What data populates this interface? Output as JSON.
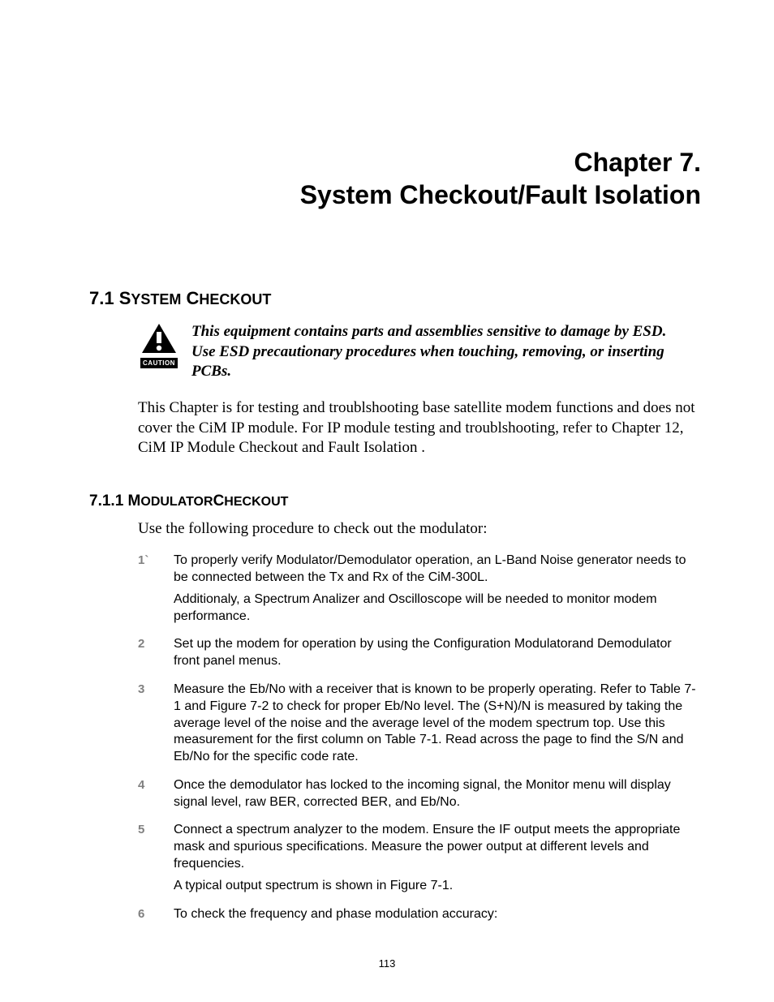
{
  "chapter": {
    "line1": "Chapter 7.",
    "line2": "System Checkout/Fault Isolation"
  },
  "section": {
    "number": "7.1",
    "title_prefix": "S",
    "title_small1": "YSTEM",
    "title_sep": " C",
    "title_small2": "HECKOUT"
  },
  "caution": {
    "label": "CAUTION",
    "text": "This equipment contains parts and assemblies sensitive to damage by ESD. Use ESD precautionary procedures when touching, removing, or inserting PCBs."
  },
  "intro": "This Chapter is for testing and troublshooting base satellite modem functions and does not cover the CiM IP module. For IP module testing and troublshooting, refer to Chapter 12, CiM IP Module Checkout and Fault Isolation .",
  "subsection": {
    "number": "7.1.1",
    "title_prefix": "M",
    "title_small1": "ODULATOR",
    "title_midcap": "C",
    "title_small2": "HECKOUT"
  },
  "procedure_intro": "Use the following procedure to check out the modulator:",
  "steps": [
    {
      "num": "1`",
      "paras": [
        "To properly verify Modulator/Demodulator operation, an L-Band Noise generator needs to be connected between the Tx and Rx of the CiM-300L.",
        "Additionaly, a Spectrum Analizer and Oscilloscope will be needed to monitor modem performance."
      ]
    },
    {
      "num": "2",
      "paras": [
        "Set up the modem for operation by using the Configuration Modulatorand Demodulator front panel menus."
      ]
    },
    {
      "num": "3",
      "paras": [
        "Measure the Eb/No with a receiver that is known to be properly operating. Refer to Table 7-1 and Figure 7-2 to check for proper Eb/No level. The (S+N)/N is measured by taking the average level of the noise and the average level of the modem spectrum top. Use this measurement for the first column on Table 7-1. Read across the page to find the S/N and Eb/No for the specific code rate."
      ]
    },
    {
      "num": "4",
      "paras": [
        "Once the demodulator has locked to the incoming signal, the Monitor menu will display signal level, raw BER, corrected BER, and Eb/No."
      ]
    },
    {
      "num": "5",
      "paras": [
        "Connect a spectrum analyzer to the modem. Ensure the IF output meets the appropriate mask and spurious specifications. Measure the power output at different levels and frequencies.",
        "A typical output spectrum is shown in Figure 7-1."
      ]
    },
    {
      "num": "6",
      "paras": [
        "To check the frequency and phase modulation accuracy:"
      ]
    }
  ],
  "page_number": "113"
}
